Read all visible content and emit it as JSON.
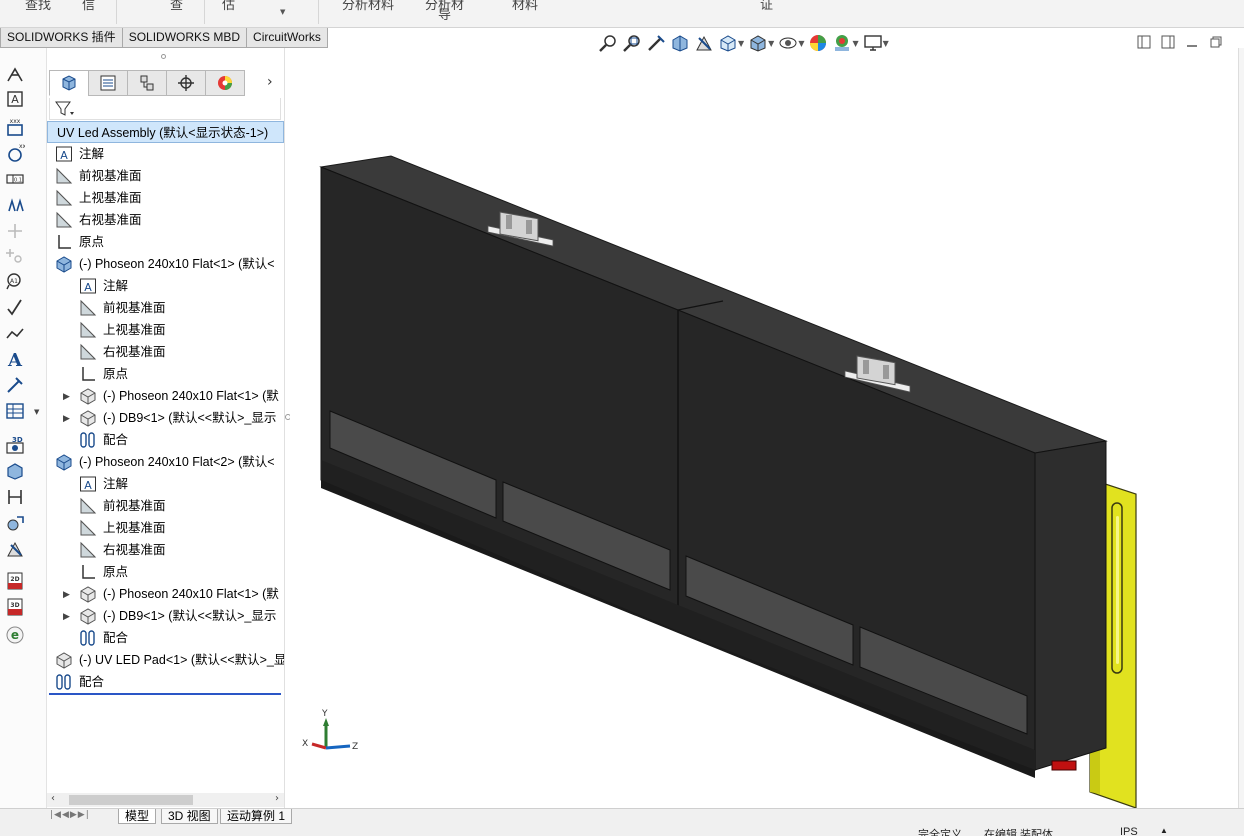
{
  "ribbon": {
    "partial_labels": [
      "查找",
      "信",
      "查",
      "估",
      "分析材料",
      "分析材",
      "导",
      "材料",
      "证"
    ]
  },
  "command_tabs": [
    "SOLIDWORKS 插件",
    "SOLIDWORKS MBD",
    "CircuitWorks"
  ],
  "left_toolbar_icons": [
    "smart-dimension-icon",
    "note-icon",
    "datum-icon",
    "datum-target-icon",
    "tolerance-icon",
    "auto-dimension-icon",
    "surface-finish-icon",
    "weld-symbol-icon",
    "text-icon",
    "leader-icon",
    "table-icon",
    "3d-view-icon",
    "section-view-icon",
    "dimxpert-icon",
    "hole-callout-icon",
    "publish-3d-pdf-icon",
    "export-3d-pdf-icon",
    "edrawings-icon"
  ],
  "feature_manager": {
    "tabs": [
      "feature-tree-tab",
      "property-tab",
      "configuration-tab",
      "dimxpert-tab",
      "display-manager-tab"
    ],
    "tree": [
      {
        "label": "UV Led Assembly  (默认<显示状态-1>)",
        "icon": "assembly-icon",
        "level": 0,
        "root": true
      },
      {
        "label": "注解",
        "icon": "annotation-icon",
        "level": 0
      },
      {
        "label": "前视基准面",
        "icon": "plane-icon",
        "level": 0
      },
      {
        "label": "上视基准面",
        "icon": "plane-icon",
        "level": 0
      },
      {
        "label": "右视基准面",
        "icon": "plane-icon",
        "level": 0
      },
      {
        "label": "原点",
        "icon": "origin-icon",
        "level": 0
      },
      {
        "label": "(-) Phoseon 240x10 Flat<1>  (默认<",
        "icon": "subassembly-icon",
        "level": 0
      },
      {
        "label": "注解",
        "icon": "annotation-icon",
        "level": 1
      },
      {
        "label": "前视基准面",
        "icon": "plane-icon",
        "level": 1
      },
      {
        "label": "上视基准面",
        "icon": "plane-icon",
        "level": 1
      },
      {
        "label": "右视基准面",
        "icon": "plane-icon",
        "level": 1
      },
      {
        "label": "原点",
        "icon": "origin-icon",
        "level": 1
      },
      {
        "label": "(-) Phoseon 240x10 Flat<1>  (默",
        "icon": "part-icon",
        "level": 1,
        "expand": true
      },
      {
        "label": "(-) DB9<1>  (默认<<默认>_显示",
        "icon": "part-icon",
        "level": 1,
        "expand": true
      },
      {
        "label": "配合",
        "icon": "mate-icon",
        "level": 1
      },
      {
        "label": "(-) Phoseon 240x10 Flat<2>  (默认<",
        "icon": "subassembly-icon",
        "level": 0
      },
      {
        "label": "注解",
        "icon": "annotation-icon",
        "level": 1
      },
      {
        "label": "前视基准面",
        "icon": "plane-icon",
        "level": 1
      },
      {
        "label": "上视基准面",
        "icon": "plane-icon",
        "level": 1
      },
      {
        "label": "右视基准面",
        "icon": "plane-icon",
        "level": 1
      },
      {
        "label": "原点",
        "icon": "origin-icon",
        "level": 1
      },
      {
        "label": "(-) Phoseon 240x10 Flat<1>  (默",
        "icon": "part-icon",
        "level": 1,
        "expand": true
      },
      {
        "label": "(-) DB9<1>  (默认<<默认>_显示",
        "icon": "part-icon",
        "level": 1,
        "expand": true
      },
      {
        "label": "配合",
        "icon": "mate-icon",
        "level": 1
      },
      {
        "label": "(-) UV LED Pad<1>  (默认<<默认>_显",
        "icon": "part-icon",
        "level": 0
      },
      {
        "label": "配合",
        "icon": "mate-icon",
        "level": 0
      }
    ]
  },
  "heads_up_toolbar": [
    "zoom-to-fit-icon",
    "zoom-to-area-icon",
    "previous-view-icon",
    "section-view-icon",
    "dynamic-annotation-icon",
    "view-orientation-icon",
    "display-style-icon",
    "hide-show-items-icon",
    "edit-appearance-icon",
    "apply-scene-icon",
    "view-settings-icon"
  ],
  "bottom_tabs": [
    "模型",
    "3D 视图",
    "运动算例 1"
  ],
  "status_bar": {
    "definition": "完全定义",
    "editing": "在编辑 装配体",
    "units": "IPS"
  },
  "triad": {
    "x": "X",
    "y": "Y",
    "z": "Z"
  }
}
